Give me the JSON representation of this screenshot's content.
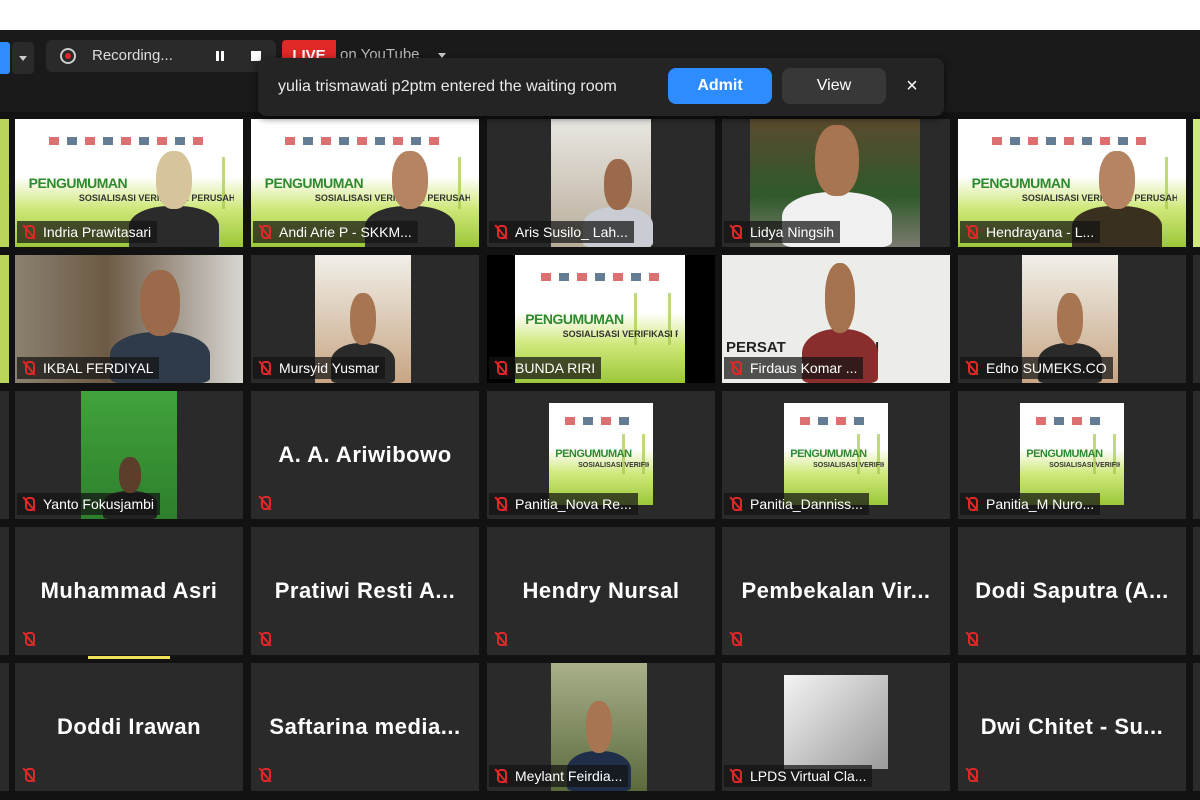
{
  "toolbar": {
    "recording_label": "Recording...",
    "live_badge": "LIVE",
    "live_target": "on YouTube",
    "icons": [
      "record-icon",
      "pause-icon",
      "stop-icon",
      "chevron-down-icon"
    ]
  },
  "notification": {
    "message": "yulia trismawati p2ptm entered the waiting room",
    "admit_label": "Admit",
    "view_label": "View",
    "close_label": "×"
  },
  "participants": [
    {
      "name": "Indria Prawitasari"
    },
    {
      "name": "Andi Arie P - SKKM..."
    },
    {
      "name": "Aris Susilo_ Lah..."
    },
    {
      "name": "Lidya Ningsih"
    },
    {
      "name": "Hendrayana - L..."
    },
    {
      "name": "IKBAL FERDIYAL"
    },
    {
      "name": "Mursyid Yusmar"
    },
    {
      "name": "BUNDA RIRI"
    },
    {
      "name": "Firdaus Komar ..."
    },
    {
      "name": "Edho SUMEKS.CO"
    },
    {
      "name": "Yanto Fokusjambi"
    },
    {
      "name": "A. A. Ariwibowo"
    },
    {
      "name": "Panitia_Nova Re..."
    },
    {
      "name": "Panitia_Danniss..."
    },
    {
      "name": "Panitia_M Nuro..."
    },
    {
      "name": "Muhammad Asri"
    },
    {
      "name": "Pratiwi Resti A..."
    },
    {
      "name": "Hendry Nursal"
    },
    {
      "name": "Pembekalan Vir..."
    },
    {
      "name": "Dodi Saputra (A..."
    },
    {
      "name": "Doddi Irawan"
    },
    {
      "name": "Saftarina media..."
    },
    {
      "name": "Meylant Feirdia..."
    },
    {
      "name": "LPDS Virtual Cla..."
    },
    {
      "name": "Dwi Chitet - Su..."
    }
  ],
  "poster": {
    "title": "PENGUMUMAN",
    "subtitle": "SOSIALISASI VERIFIKASI PERUSAHAAN PERS"
  },
  "backdrop_text": "PERSAT         RAWAN",
  "colors": {
    "accent": "#2d8cff",
    "live": "#e02828",
    "muted_icon": "#e02828",
    "active_speaker_border": "#7bd23f",
    "tile_bg": "#2a2a2a",
    "poster_green": "#9bc739"
  }
}
